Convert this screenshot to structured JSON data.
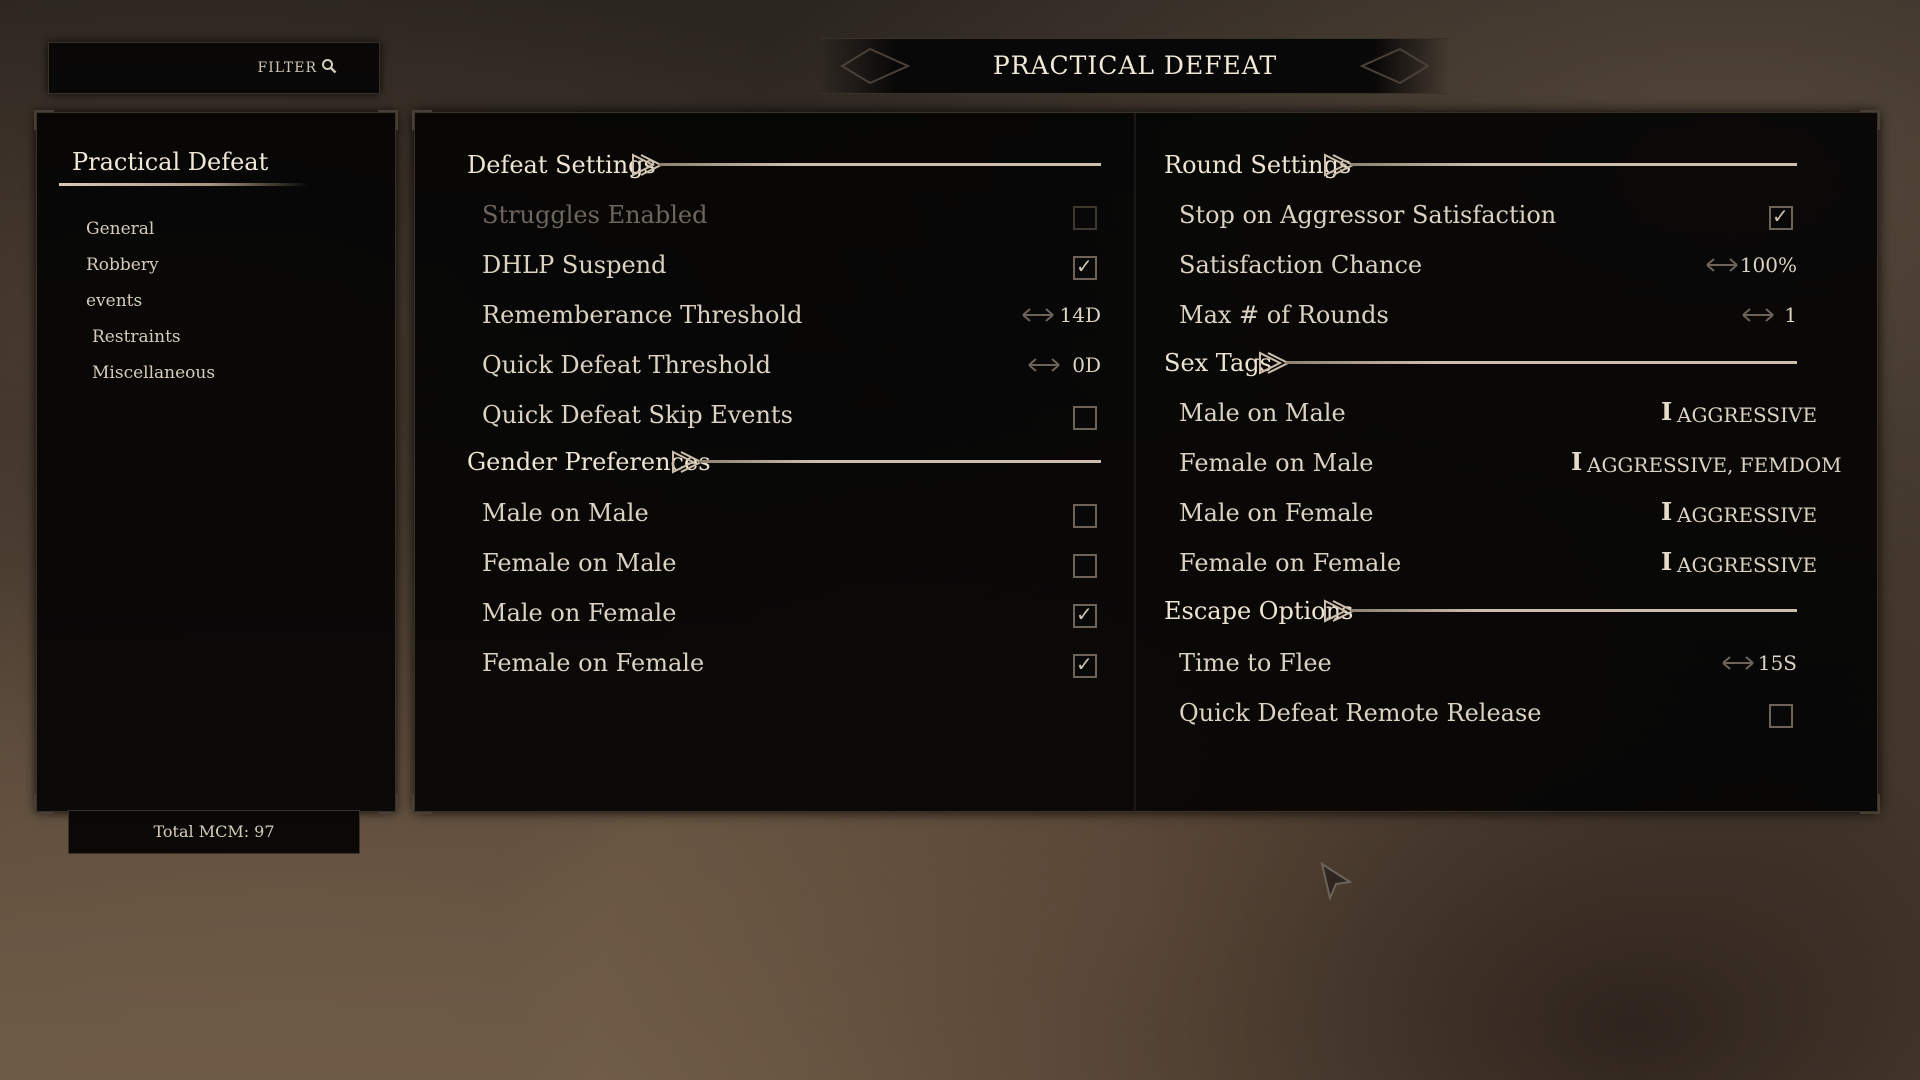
{
  "filter": {
    "label": "FILTER",
    "icon": "search-icon"
  },
  "title": "PRACTICAL DEFEAT",
  "sidebar": {
    "mod_title": "Practical Defeat",
    "items": [
      {
        "label": "General"
      },
      {
        "label": "Robbery"
      },
      {
        "label": "events"
      },
      {
        "label": "Restraints"
      },
      {
        "label": "Miscellaneous"
      }
    ]
  },
  "footer": {
    "total": "Total MCM: 97"
  },
  "left_column": {
    "defeat_settings": {
      "header": "Defeat Settings",
      "struggles_enabled": {
        "label": "Struggles Enabled",
        "checked": false,
        "disabled": true
      },
      "dhlp_suspend": {
        "label": "DHLP Suspend",
        "checked": true
      },
      "rememberance_threshold": {
        "label": "Rememberance Threshold",
        "value": "14D"
      },
      "quick_defeat_threshold": {
        "label": "Quick Defeat Threshold",
        "value": "0D"
      },
      "quick_defeat_skip_events": {
        "label": "Quick Defeat Skip Events",
        "checked": false
      }
    },
    "gender_preferences": {
      "header": "Gender Preferences",
      "male_on_male": {
        "label": "Male on Male",
        "checked": false
      },
      "female_on_male": {
        "label": "Female on Male",
        "checked": false
      },
      "male_on_female": {
        "label": "Male on Female",
        "checked": true
      },
      "female_on_female": {
        "label": "Female on Female",
        "checked": true
      }
    }
  },
  "right_column": {
    "round_settings": {
      "header": "Round Settings",
      "stop_on_aggressor": {
        "label": "Stop on Aggressor Satisfaction",
        "checked": true
      },
      "satisfaction_chance": {
        "label": "Satisfaction Chance",
        "value": "100%"
      },
      "max_rounds": {
        "label": "Max # of Rounds",
        "value": "1"
      }
    },
    "sex_tags": {
      "header": "Sex Tags",
      "male_on_male": {
        "label": "Male on Male",
        "value": "AGGRESSIVE"
      },
      "female_on_male": {
        "label": "Female on Male",
        "value": "AGGRESSIVE, FEMDOM"
      },
      "male_on_female": {
        "label": "Male on Female",
        "value": "AGGRESSIVE"
      },
      "female_on_female": {
        "label": "Female on Female",
        "value": "AGGRESSIVE"
      }
    },
    "escape_options": {
      "header": "Escape Options",
      "time_to_flee": {
        "label": "Time to Flee",
        "value": "15S"
      },
      "quick_defeat_remote_release": {
        "label": "Quick Defeat Remote Release",
        "checked": false
      }
    }
  },
  "colors": {
    "accent": "#cdbfab",
    "panel": "#040404",
    "text": "#dcd2c1"
  }
}
